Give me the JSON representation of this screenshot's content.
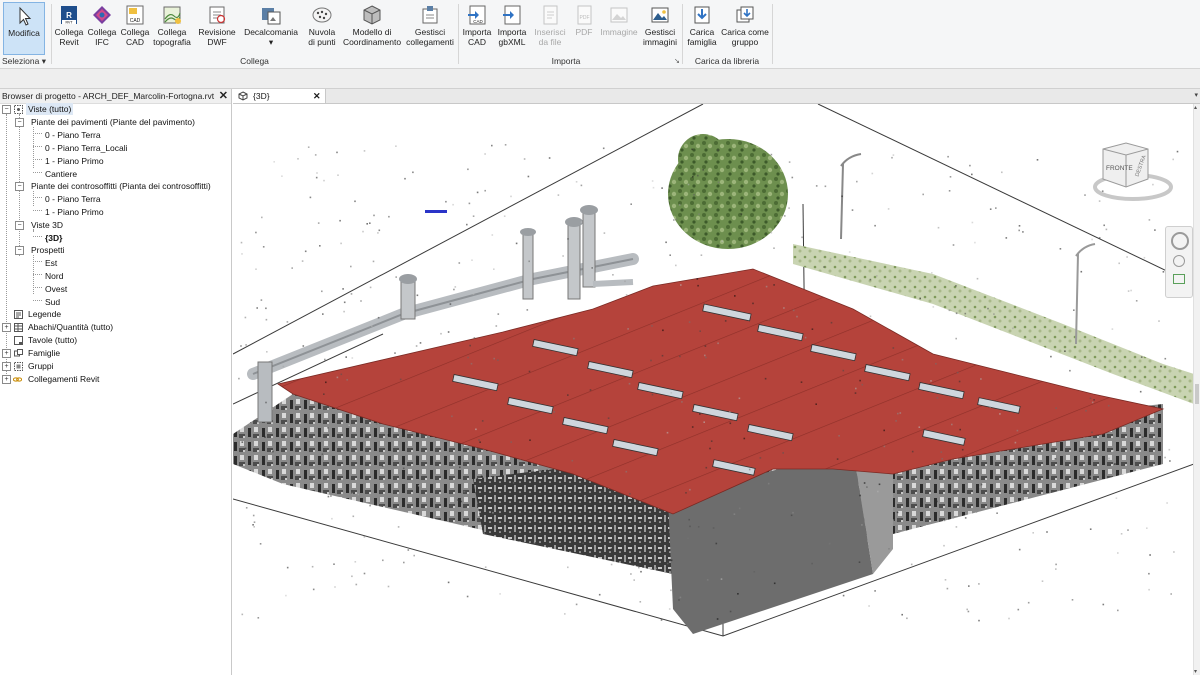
{
  "ribbon": {
    "modify": {
      "label": "Modifica",
      "icon": "cursor-icon"
    },
    "select": {
      "label": "Seleziona"
    },
    "collega_group": "Collega",
    "importa_group": "Importa",
    "libreria_group": "Carica da libreria",
    "buttons": [
      {
        "line1": "Collega",
        "line2": "Revit",
        "icon": "revit-link-icon"
      },
      {
        "line1": "Collega",
        "line2": "IFC",
        "icon": "ifc-link-icon"
      },
      {
        "line1": "Collega",
        "line2": "CAD",
        "icon": "cad-link-icon"
      },
      {
        "line1": "Collega",
        "line2": "topografia",
        "icon": "topography-icon"
      },
      {
        "line1": "Revisione",
        "line2": "DWF",
        "icon": "dwf-icon"
      },
      {
        "line1": "Decalcomania",
        "line2": "▾",
        "icon": "decal-icon"
      },
      {
        "line1": "Nuvola",
        "line2": "di punti",
        "icon": "point-cloud-icon"
      },
      {
        "line1": "Modello di",
        "line2": "Coordinamento",
        "icon": "coordination-model-icon"
      },
      {
        "line1": "Gestisci",
        "line2": "collegamenti",
        "icon": "manage-links-icon"
      },
      {
        "line1": "Importa",
        "line2": "CAD",
        "icon": "import-cad-icon"
      },
      {
        "line1": "Importa",
        "line2": "gbXML",
        "icon": "import-gbxml-icon"
      },
      {
        "line1": "Inserisci",
        "line2": "da file",
        "icon": "insert-file-icon"
      },
      {
        "line1": "PDF",
        "line2": "",
        "icon": "pdf-icon"
      },
      {
        "line1": "Immagine",
        "line2": "",
        "icon": "image-icon"
      },
      {
        "line1": "Gestisci",
        "line2": "immagini",
        "icon": "manage-images-icon"
      },
      {
        "line1": "Carica",
        "line2": "famiglia",
        "icon": "load-family-icon"
      },
      {
        "line1": "Carica come",
        "line2": "gruppo",
        "icon": "load-group-icon"
      }
    ]
  },
  "browser": {
    "title": "Browser di progetto - ARCH_DEF_Marcolin-Fortogna.rvt",
    "close": "✕",
    "tree": [
      {
        "label": "Viste (tutto)"
      },
      {
        "label": "Piante dei pavimenti (Piante del pavimento)"
      },
      {
        "label": "0 - Piano Terra"
      },
      {
        "label": "0 - Piano Terra_Locali"
      },
      {
        "label": "1 - Piano Primo"
      },
      {
        "label": "Cantiere"
      },
      {
        "label": "Piante dei controsoffitti (Pianta dei controsoffitti)"
      },
      {
        "label": "0 - Piano Terra"
      },
      {
        "label": "1 - Piano Primo"
      },
      {
        "label": "Viste 3D"
      },
      {
        "label": "{3D}"
      },
      {
        "label": "Prospetti"
      },
      {
        "label": "Est"
      },
      {
        "label": "Nord"
      },
      {
        "label": "Ovest"
      },
      {
        "label": "Sud"
      },
      {
        "label": "Legende"
      },
      {
        "label": "Abachi/Quantità (tutto)"
      },
      {
        "label": "Tavole (tutto)"
      },
      {
        "label": "Famiglie"
      },
      {
        "label": "Gruppi"
      },
      {
        "label": "Collegamenti Revit"
      }
    ]
  },
  "view": {
    "tab_label": "{3D}",
    "tab_close": "✕",
    "viewcube_front": "FRONTE",
    "viewcube_right": "DESTRA"
  },
  "colors": {
    "roof": "#b5433b",
    "ribbon_bg": "#f5f6f7",
    "selected": "#cde3f7"
  }
}
